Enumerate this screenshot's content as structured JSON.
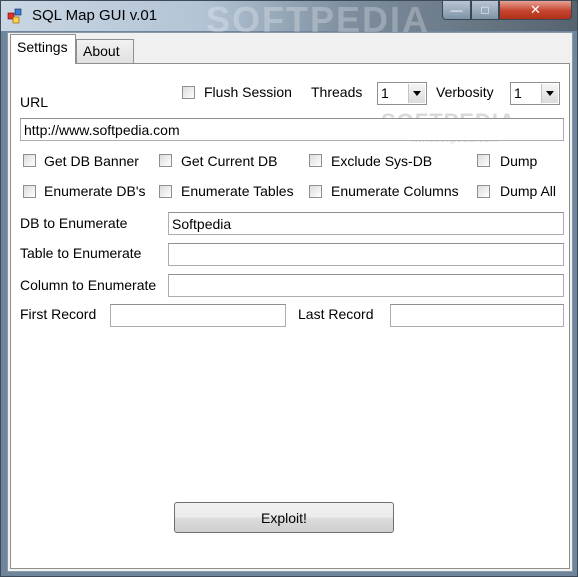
{
  "window": {
    "title": "SQL Map GUI v.01",
    "title_watermark": "SOFTPEDIA",
    "controls": {
      "minimize": "—",
      "maximize": "□",
      "close": "✕"
    }
  },
  "tabs": [
    {
      "label": "Settings"
    },
    {
      "label": "About"
    }
  ],
  "watermark": {
    "big": "SOFTPEDIA",
    "small": "www.softpedia.com"
  },
  "settings": {
    "url_label": "URL",
    "url_value": "http://www.softpedia.com",
    "flush_session_label": "Flush Session",
    "threads_label": "Threads",
    "threads_value": "1",
    "verbosity_label": "Verbosity",
    "verbosity_value": "1",
    "checkboxes": [
      {
        "label": "Get DB Banner"
      },
      {
        "label": "Get Current DB"
      },
      {
        "label": "Exclude Sys-DB"
      },
      {
        "label": "Dump"
      },
      {
        "label": "Enumerate DB's"
      },
      {
        "label": "Enumerate Tables"
      },
      {
        "label": "Enumerate Columns"
      },
      {
        "label": "Dump All"
      }
    ],
    "db_label": "DB to Enumerate",
    "db_value": "Softpedia",
    "table_label": "Table to Enumerate",
    "table_value": "",
    "column_label": "Column to Enumerate",
    "column_value": "",
    "first_record_label": "First Record",
    "first_record_value": "",
    "last_record_label": "Last Record",
    "last_record_value": "",
    "exploit_label": "Exploit!"
  }
}
